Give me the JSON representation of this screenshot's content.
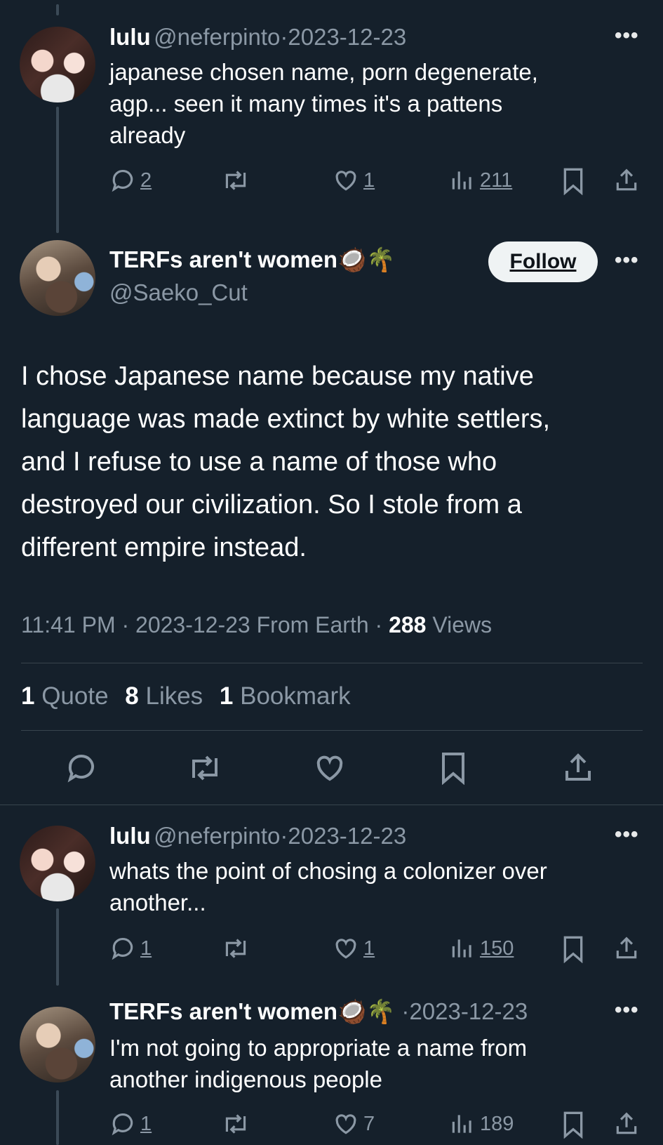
{
  "tweet1": {
    "name": "lulu",
    "handle": "@neferpinto",
    "date": "2023-12-23",
    "text_lines": [
      "japanese chosen name, porn degenerate,",
      "agp...  seen it many times it's a pattens",
      "already"
    ],
    "replies": "2",
    "likes": "1",
    "views": "211"
  },
  "main": {
    "name": "TERFs aren't women",
    "emojis": "🥥🌴",
    "handle": "@Saeko_Cut",
    "follow_label": "Follow",
    "text_lines": [
      "I chose Japanese name because my native",
      "language was made extinct by white settlers,",
      "and I refuse to use a name of those who",
      "destroyed our civilization. So I stole from a",
      "different empire instead."
    ],
    "time": "11:41 PM · 2023-12-23 From Earth · ",
    "views_num": "288",
    "views_label": " Views",
    "quotes_num": "1",
    "quotes_label": " Quote",
    "likes_num": "8",
    "likes_label": " Likes",
    "bookmarks_num": "1",
    "bookmarks_label": " Bookmark"
  },
  "tweet2": {
    "name": "lulu",
    "handle": "@neferpinto",
    "date": "2023-12-23",
    "text_lines": [
      "whats the point of chosing a colonizer over",
      "another..."
    ],
    "replies": "1",
    "likes": "1",
    "views": "150"
  },
  "tweet3": {
    "name": "TERFs aren't women",
    "emojis": "🥥🌴",
    "date": "2023-12-23",
    "text_lines": [
      "I'm not going to appropriate a name from",
      "another indigenous people"
    ],
    "replies": "1",
    "likes": "7",
    "views": "189"
  },
  "icons": [
    "reply-icon",
    "retweet-icon",
    "like-icon",
    "views-icon",
    "bookmark-icon",
    "share-icon",
    "more-icon"
  ]
}
